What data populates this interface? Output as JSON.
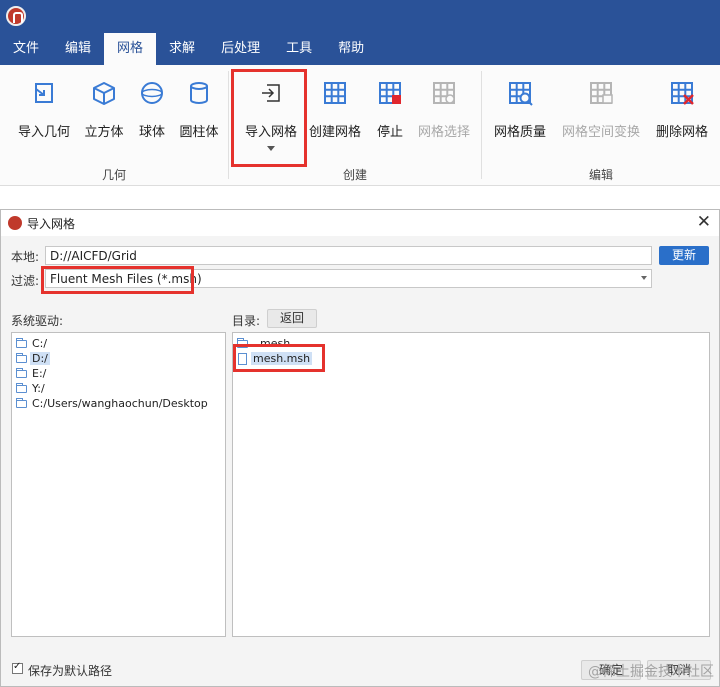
{
  "app": {
    "logo_icon": "app-logo-icon"
  },
  "menubar": {
    "items": [
      {
        "label": "文件"
      },
      {
        "label": "编辑"
      },
      {
        "label": "网格"
      },
      {
        "label": "求解"
      },
      {
        "label": "后处理"
      },
      {
        "label": "工具"
      },
      {
        "label": "帮助"
      }
    ],
    "active_index": 2
  },
  "ribbon": {
    "groups": [
      {
        "label": "几何",
        "buttons": [
          {
            "label": "导入几何",
            "icon": "import-geometry-icon"
          },
          {
            "label": "立方体",
            "icon": "cube-icon"
          },
          {
            "label": "球体",
            "icon": "sphere-icon"
          },
          {
            "label": "圆柱体",
            "icon": "cylinder-icon"
          }
        ]
      },
      {
        "label": "创建",
        "buttons": [
          {
            "label": "导入网格",
            "icon": "import-mesh-icon"
          },
          {
            "label": "创建网格",
            "icon": "create-mesh-icon"
          },
          {
            "label": "停止",
            "icon": "stop-mesh-icon"
          },
          {
            "label": "网格选择",
            "icon": "mesh-select-icon",
            "disabled": true
          }
        ]
      },
      {
        "label": "编辑",
        "buttons": [
          {
            "label": "网格质量",
            "icon": "mesh-quality-icon"
          },
          {
            "label": "网格空间变换",
            "icon": "mesh-transform-icon",
            "disabled": true
          },
          {
            "label": "删除网格",
            "icon": "delete-mesh-icon"
          }
        ]
      }
    ]
  },
  "dialog": {
    "title": "导入网格",
    "local_label": "本地:",
    "local_path": "D://AICFD/Grid",
    "refresh_label": "更新",
    "filter_label": "过滤:",
    "filter_value": "Fluent Mesh Files (*.msh)",
    "drives_label": "系统驱动:",
    "dir_label": "目录:",
    "back_label": "返回",
    "drives": [
      {
        "label": "C:/"
      },
      {
        "label": "D:/",
        "selected": true
      },
      {
        "label": "E:/"
      },
      {
        "label": "Y:/"
      },
      {
        "label": "C:/Users/wanghaochun/Desktop"
      }
    ],
    "files": [
      {
        "label": "..mesh",
        "type": "folder"
      },
      {
        "label": "mesh.msh",
        "type": "file",
        "selected": true
      }
    ],
    "save_default_label": "保存为默认路径",
    "save_default_checked": true,
    "ok_label": "确定",
    "cancel_label": "取消"
  },
  "watermark": "@稀土掘金技术社区",
  "colors": {
    "brand_blue": "#2a5298",
    "highlight_red": "#e5322d",
    "accent_blue": "#2a6fc9"
  }
}
